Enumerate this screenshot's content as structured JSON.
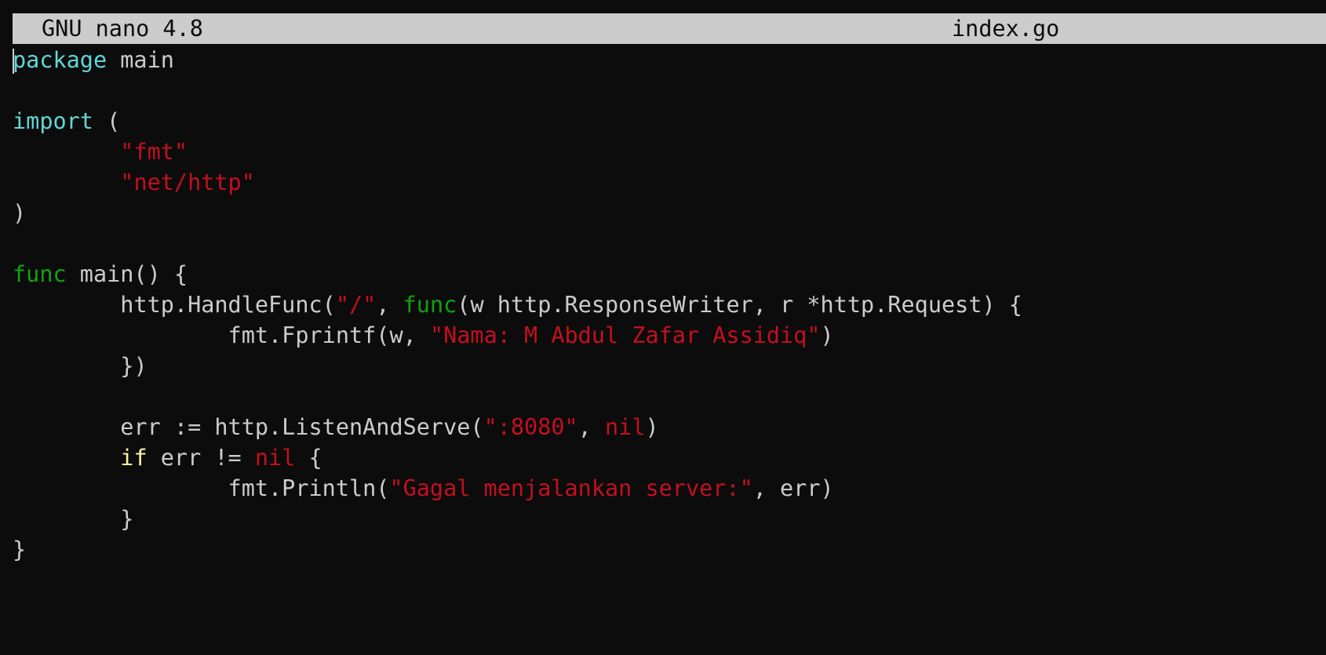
{
  "titlebar": {
    "version": "GNU nano 4.8",
    "filename": "index.go"
  },
  "code": {
    "l1_a": "package",
    "l1_b": " main",
    "l3_a": "import",
    "l3_b": " (",
    "l4_str": "\"fmt\"",
    "l5_str": "\"net/http\"",
    "l6": ")",
    "l8_a": "func",
    "l8_b": " main() {",
    "l9_a": "http.HandleFunc(",
    "l9_b": "\"/\"",
    "l9_c": ", ",
    "l9_d": "func",
    "l9_e": "(w http.ResponseWriter, r *http.Request) {",
    "l10_a": "fmt.Fprintf(w, ",
    "l10_b": "\"Nama: M Abdul Zafar Assidiq\"",
    "l10_c": ")",
    "l11": "})",
    "l13_a": "err := http.ListenAndServe(",
    "l13_b": "\":8080\"",
    "l13_c": ", ",
    "l13_d": "nil",
    "l13_e": ")",
    "l14_a": "if",
    "l14_b": " err != ",
    "l14_c": "nil",
    "l14_d": " {",
    "l15_a": "fmt.Println(",
    "l15_b": "\"Gagal menjalankan server:\"",
    "l15_c": ", err)",
    "l16": "}",
    "l17": "}"
  },
  "colors": {
    "background": "#0c0c0c",
    "foreground": "#cccccc",
    "keyword": "#61d6d6",
    "func_keyword": "#13a10e",
    "string": "#c50f1f",
    "control": "#f9f1a5"
  }
}
